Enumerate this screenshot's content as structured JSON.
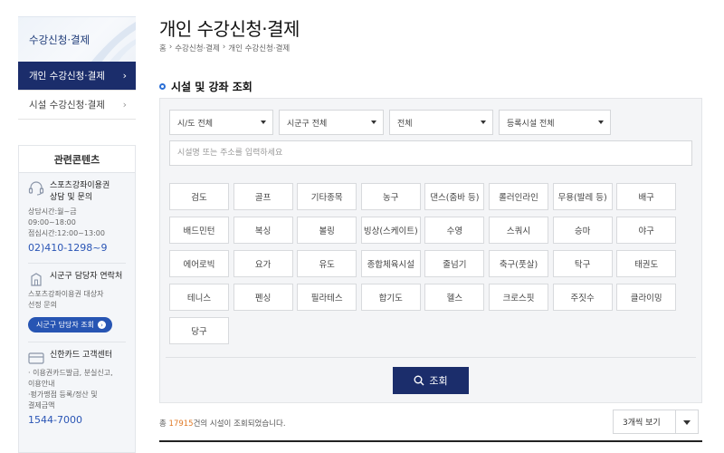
{
  "sidebar": {
    "header": "수강신청·결제",
    "items": [
      {
        "label": "개인 수강신청·결제",
        "active": true
      },
      {
        "label": "시설 수강신청·결제",
        "active": false
      }
    ],
    "chevron": "›"
  },
  "related": {
    "title": "관련콘텐츠",
    "consult": {
      "icon": "headset-icon",
      "title_line1": "스포츠강좌이용권",
      "title_line2": "상담 및 문의",
      "hours1": "상담시간:월~금 09:00~18:00",
      "hours2": "점심시간:12:00~13:00",
      "phone": "02)410-1298~9"
    },
    "contact": {
      "icon": "building-icon",
      "title": "시군구 담당자 연락처",
      "desc1": "스포츠강좌이용권 대상자",
      "desc2": "선정 문의",
      "button": "시군구 담당자 조회",
      "button_icon": "›"
    },
    "card": {
      "icon": "card-icon",
      "title": "신한카드 고객센터",
      "desc1": "· 이용권카드발급, 분실신고,",
      "desc2": "이용안내",
      "desc3": "·펑가맹점 등록/정산 및",
      "desc4": "결제금액",
      "phone": "1544-7000"
    }
  },
  "main": {
    "title": "개인 수강신청·결제",
    "breadcrumb": [
      "홈",
      "›",
      "수강신청·결제",
      "›",
      "개인 수강신청·결제"
    ],
    "section_title": "시설 및 강좌 조회",
    "filters": {
      "sido": "시/도 전체",
      "sigungu": "시군구 전체",
      "type": "전체",
      "facility": "등록시설 전체"
    },
    "search_placeholder": "시설명 또는 주소를 입력하세요",
    "sports": [
      "검도",
      "골프",
      "기타종목",
      "농구",
      "댄스(줌바 등)",
      "롤러인라인",
      "무용(발레 등)",
      "배구",
      "배드민턴",
      "복싱",
      "볼링",
      "빙상(스케이트)",
      "수영",
      "스쿼시",
      "승마",
      "야구",
      "에어로빅",
      "요가",
      "유도",
      "종합체육시설",
      "줄넘기",
      "축구(풋살)",
      "탁구",
      "태권도",
      "테니스",
      "펜싱",
      "필라테스",
      "합기도",
      "헬스",
      "크로스핏",
      "주짓수",
      "클라이밍",
      "당구"
    ],
    "search_button": "조회",
    "result": {
      "prefix": "총 ",
      "count": "17915",
      "suffix": "건의 시설이 조회되었습니다."
    },
    "view_option": "3개씩 보기"
  },
  "colors": {
    "navy": "#1b2d6b",
    "accent_blue": "#2a6fd6",
    "count_orange": "#e07a27"
  }
}
